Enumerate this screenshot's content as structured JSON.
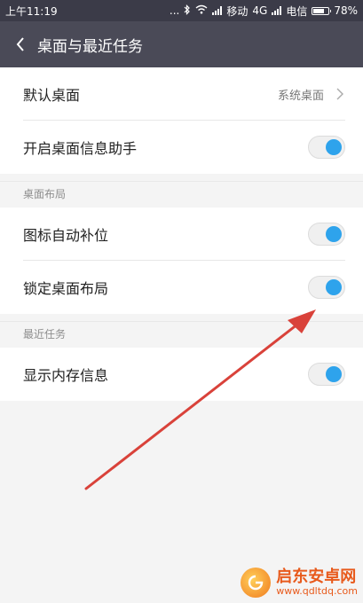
{
  "status_bar": {
    "time": "上午11:19",
    "dots": "...",
    "carrier1": "移动",
    "network": "4G",
    "carrier2": "电信",
    "battery": "78%",
    "battery_level": 0.78
  },
  "header": {
    "title": "桌面与最近任务"
  },
  "rows": {
    "default_desktop": {
      "label": "默认桌面",
      "value": "系统桌面"
    },
    "desktop_assistant": {
      "label": "开启桌面信息助手",
      "on": true
    }
  },
  "sections": {
    "layout": {
      "title": "桌面布局",
      "auto_fill": {
        "label": "图标自动补位",
        "on": true
      },
      "lock_layout": {
        "label": "锁定桌面布局",
        "on": true
      }
    },
    "recent": {
      "title": "最近任务",
      "show_memory": {
        "label": "显示内存信息",
        "on": true
      }
    }
  },
  "watermark": {
    "name": "启东安卓网",
    "url": "www.qdltdq.com"
  },
  "colors": {
    "status_bar": "#3b3b48",
    "header": "#4a4a57",
    "toggle_on": "#2ea3ec",
    "arrow": "#d9423a"
  }
}
